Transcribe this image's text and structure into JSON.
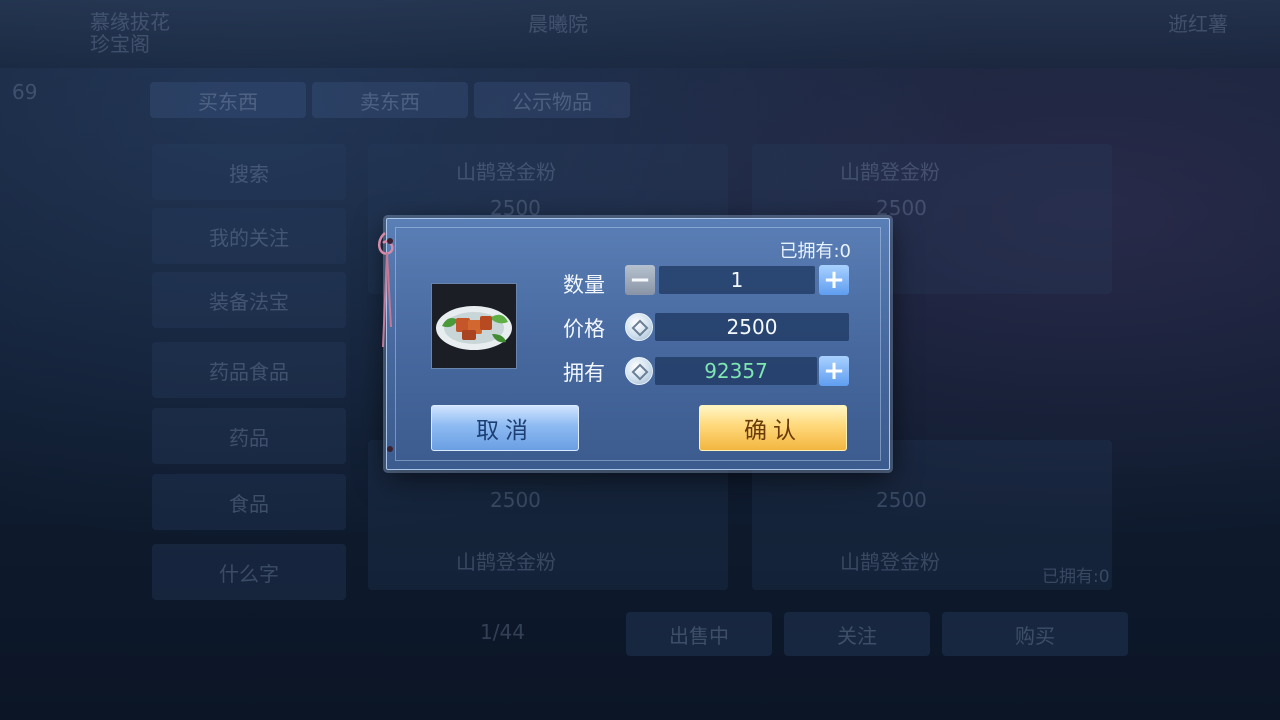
{
  "background": {
    "top_left_text": "慕缘拔花",
    "top_left_sub": "珍宝阁",
    "level": "69",
    "center_top_text": "晨曦院",
    "top_right_text": "逝红薯",
    "tabs": [
      "买东西",
      "卖东西",
      "公示物品"
    ],
    "side_items": [
      "搜索",
      "我的关注",
      "装备法宝",
      "药品食品",
      "药品",
      "食品",
      "什么字"
    ],
    "prices": [
      "2500",
      "2500",
      "2500",
      "2500",
      "2500",
      "2500"
    ],
    "item_names": [
      "山鹊登金粉",
      "山鹊登金粉",
      "山鹊登金粉",
      "山鹊登金粉"
    ],
    "page": "1/44",
    "bottom_buttons": [
      "出售中",
      "关注",
      "购买"
    ],
    "owned_bg": "已拥有:0"
  },
  "dialog": {
    "owned_label": "已拥有:0",
    "quantity_label": "数量",
    "quantity_value": "1",
    "price_label": "价格",
    "price_value": "2500",
    "have_label": "拥有",
    "have_value": "92357",
    "cancel_label": "取消",
    "confirm_label": "确认",
    "colors": {
      "accent_blue": "#6a9fe3",
      "accent_gold": "#f2b640",
      "money_green": "#7fe6b2"
    }
  }
}
